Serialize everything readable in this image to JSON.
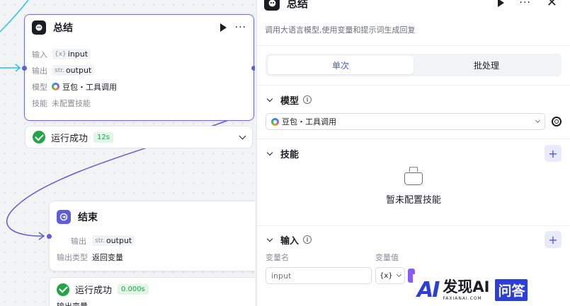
{
  "canvas": {
    "summary_node": {
      "title": "总结",
      "rows": [
        {
          "label": "输入",
          "type": "{x}",
          "value": "input"
        },
        {
          "label": "输出",
          "type": "str.",
          "value": "output"
        }
      ],
      "model_label": "模型",
      "model_value": "豆包・工具调用",
      "skill_label": "技能",
      "skill_value": "未配置技能"
    },
    "summary_status": {
      "text": "运行成功",
      "time": "12s"
    },
    "end_node": {
      "title": "结束",
      "output_label": "输出",
      "output_type": "str.",
      "output_value": "output",
      "output_type_label": "输出类型",
      "output_type_value": "返回变量"
    },
    "end_status": {
      "text": "运行成功",
      "time": "0.000s",
      "extra": "输出变量"
    }
  },
  "panel": {
    "title": "总结",
    "description": "调用大语言模型,使用变量和提示词生成回复",
    "tabs": [
      {
        "label": "单次",
        "active": true
      },
      {
        "label": "批处理",
        "active": false
      }
    ],
    "model_section": {
      "title": "模型",
      "selected": "豆包・工具调用"
    },
    "skill_section": {
      "title": "技能",
      "empty_text": "暂未配置技能"
    },
    "input_section": {
      "title": "输入",
      "col_name": "变量名",
      "col_value": "变量值",
      "row_name_placeholder": "input",
      "row_type": "{x}"
    }
  },
  "watermark": {
    "logo": "AI",
    "title": "发现AI",
    "subtitle": "FAXIANAI.COM",
    "badge": "问答"
  },
  "colors": {
    "accent": "#4d53e8",
    "node_selected": "#6d6fd8",
    "success": "#22a447",
    "edge": "#5e5fd6",
    "edge_cyan": "#2cc3e8"
  }
}
